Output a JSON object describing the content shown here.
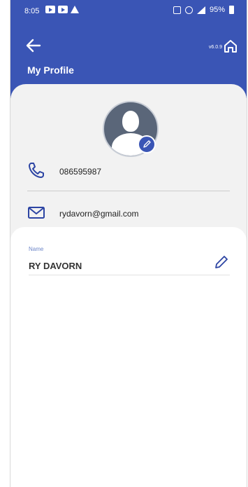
{
  "status_bar": {
    "time": "8:05",
    "battery": "95%"
  },
  "header": {
    "version": "v6.0.9",
    "title": "My Profile"
  },
  "profile": {
    "phone": "086595987",
    "email": "rydavorn@gmail.com"
  },
  "name_field": {
    "label": "Name",
    "value": "RY DAVORN"
  },
  "colors": {
    "primary": "#3a55b5",
    "background": "#f2f2f2",
    "label": "#6d86c8"
  },
  "icons": {
    "back": "arrow-left-icon",
    "home": "home-icon",
    "phone": "phone-icon",
    "email": "mail-icon",
    "edit": "pencil-icon"
  }
}
